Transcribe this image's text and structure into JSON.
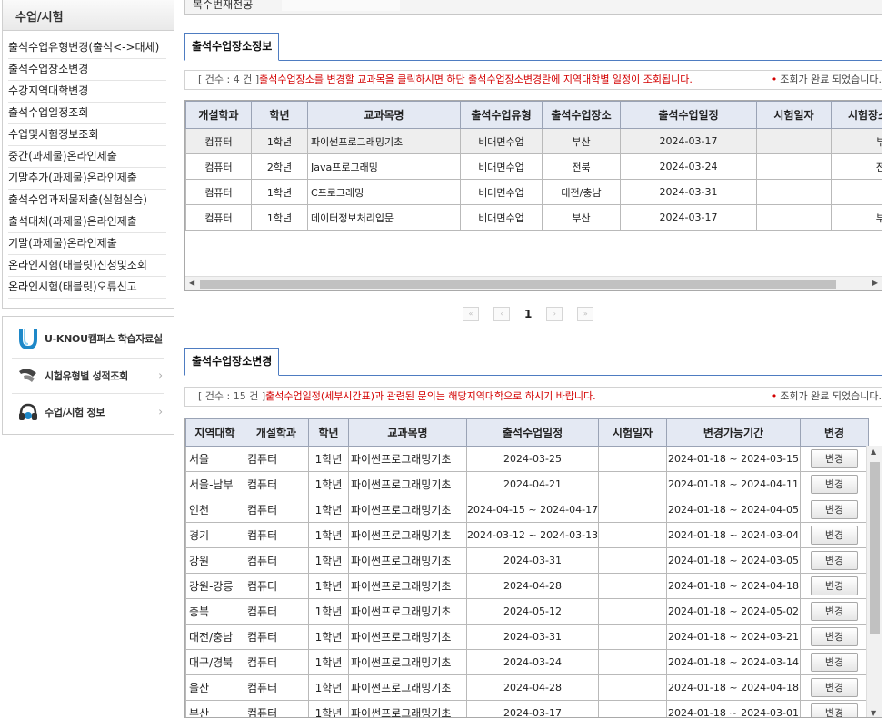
{
  "sidebar": {
    "title": "수업/시험",
    "items": [
      "출석수업유형변경(출석<->대체)",
      "출석수업장소변경",
      "수강지역대학변경",
      "출석수업일정조회",
      "수업및시험정보조회",
      "중간(과제물)온라인제출",
      "기말추가(과제물)온라인제출",
      "출석수업과제물제출(실험실습)",
      "출석대체(과제물)온라인제출",
      "기말(과제물)온라인제출",
      "온라인시험(태블릿)신청및조회",
      "온라인시험(태블릿)오류신고"
    ]
  },
  "quick_links": [
    {
      "label": "U-KNOU캠퍼스 학습자료실",
      "icon": "u-knou-logo-icon"
    },
    {
      "label": "시험유형별 성적조회",
      "icon": "pen-icon"
    },
    {
      "label": "수업/시험 정보",
      "icon": "headset-icon"
    }
  ],
  "top_row": {
    "label": "복수번재전공"
  },
  "section1": {
    "title": "출석수업장소정보",
    "count": "[ 건수 : 4 건 ]",
    "message": "출석수업장소를 변경할 교과목을 클릭하시면 하단 출석수업장소변경란에 지역대학별 일정이 조회됩니다.",
    "status": "조회가 완료 되었습니다.",
    "columns": [
      "개설학과",
      "학년",
      "교과목명",
      "출석수업유형",
      "출석수업장소",
      "출석수업일정",
      "시험일자",
      "시험장소"
    ],
    "rows": [
      [
        "컴퓨터",
        "1학년",
        "파이썬프로그래밍기초",
        "비대면수업",
        "부산",
        "2024-03-17",
        "",
        "부산"
      ],
      [
        "컴퓨터",
        "2학년",
        "Java프로그래밍",
        "비대면수업",
        "전북",
        "2024-03-24",
        "",
        "전북"
      ],
      [
        "컴퓨터",
        "1학년",
        "C프로그래밍",
        "비대면수업",
        "대전/충남",
        "2024-03-31",
        "",
        ""
      ],
      [
        "컴퓨터",
        "1학년",
        "데이터정보처리입문",
        "비대면수업",
        "부산",
        "2024-03-17",
        "",
        "부산"
      ]
    ]
  },
  "pager": {
    "first": "«",
    "prev": "‹",
    "current": "1",
    "next": "›",
    "last": "»"
  },
  "section2": {
    "title": "출석수업장소변경",
    "count": "[ 건수 : 15 건 ]",
    "message": "출석수업일정(세부시간표)과 관련된 문의는 해당지역대학으로 하시기 바랍니다.",
    "status": "조회가 완료 되었습니다.",
    "columns": [
      "지역대학",
      "개설학과",
      "학년",
      "교과목명",
      "출석수업일정",
      "시험일자",
      "변경가능기간",
      "변경"
    ],
    "button_label": "변경",
    "rows": [
      [
        "서울",
        "컴퓨터",
        "1학년",
        "파이썬프로그래밍기초",
        "2024-03-25",
        "",
        "2024-01-18 ~ 2024-03-15"
      ],
      [
        "서울-남부",
        "컴퓨터",
        "1학년",
        "파이썬프로그래밍기초",
        "2024-04-21",
        "",
        "2024-01-18 ~ 2024-04-11"
      ],
      [
        "인천",
        "컴퓨터",
        "1학년",
        "파이썬프로그래밍기초",
        "2024-04-15 ~ 2024-04-17",
        "",
        "2024-01-18 ~ 2024-04-05"
      ],
      [
        "경기",
        "컴퓨터",
        "1학년",
        "파이썬프로그래밍기초",
        "2024-03-12 ~ 2024-03-13",
        "",
        "2024-01-18 ~ 2024-03-04"
      ],
      [
        "강원",
        "컴퓨터",
        "1학년",
        "파이썬프로그래밍기초",
        "2024-03-31",
        "",
        "2024-01-18 ~ 2024-03-05"
      ],
      [
        "강원-강릉",
        "컴퓨터",
        "1학년",
        "파이썬프로그래밍기초",
        "2024-04-28",
        "",
        "2024-01-18 ~ 2024-04-18"
      ],
      [
        "충북",
        "컴퓨터",
        "1학년",
        "파이썬프로그래밍기초",
        "2024-05-12",
        "",
        "2024-01-18 ~ 2024-05-02"
      ],
      [
        "대전/충남",
        "컴퓨터",
        "1학년",
        "파이썬프로그래밍기초",
        "2024-03-31",
        "",
        "2024-01-18 ~ 2024-03-21"
      ],
      [
        "대구/경북",
        "컴퓨터",
        "1학년",
        "파이썬프로그래밍기초",
        "2024-03-24",
        "",
        "2024-01-18 ~ 2024-03-14"
      ],
      [
        "울산",
        "컴퓨터",
        "1학년",
        "파이썬프로그래밍기초",
        "2024-04-28",
        "",
        "2024-01-18 ~ 2024-04-18"
      ],
      [
        "부산",
        "컴퓨터",
        "1학년",
        "파이썬프로그래밍기초",
        "2024-03-17",
        "",
        "2024-01-18 ~ 2024-03-01"
      ]
    ]
  },
  "colors": {
    "accent_blue": "#4e7cc1",
    "alert_red": "#d30000",
    "header_bg": "#e4e9f3"
  }
}
